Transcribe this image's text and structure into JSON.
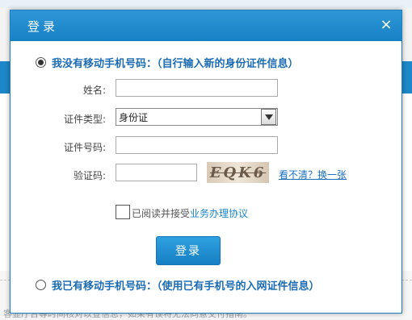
{
  "modal": {
    "title": "登录",
    "close_label": "×"
  },
  "option_no_mobile": {
    "label": "我没有移动手机号码：（自行输入新的身份证件信息）",
    "checked": true
  },
  "form": {
    "name_label": "姓名:",
    "name_value": "",
    "id_type_label": "证件类型:",
    "id_type_value": "身份证",
    "id_number_label": "证件号码:",
    "id_number_value": "",
    "captcha_label": "验证码:",
    "captcha_value": "",
    "captcha_image_text": "EQK6",
    "refresh_link": "看不清？换一张"
  },
  "agreement": {
    "prefix": "已阅读并接受",
    "link": "业务办理协议",
    "checked": false
  },
  "login_button": "登录",
  "option_has_mobile": {
    "label": "我已有移动手机号码：（使用已有手机号的入网证件信息）",
    "checked": false
  },
  "background": {
    "bottom_text": "客显厅台等时间核对以登信息，如果有误将无法同意交付指南。"
  }
}
